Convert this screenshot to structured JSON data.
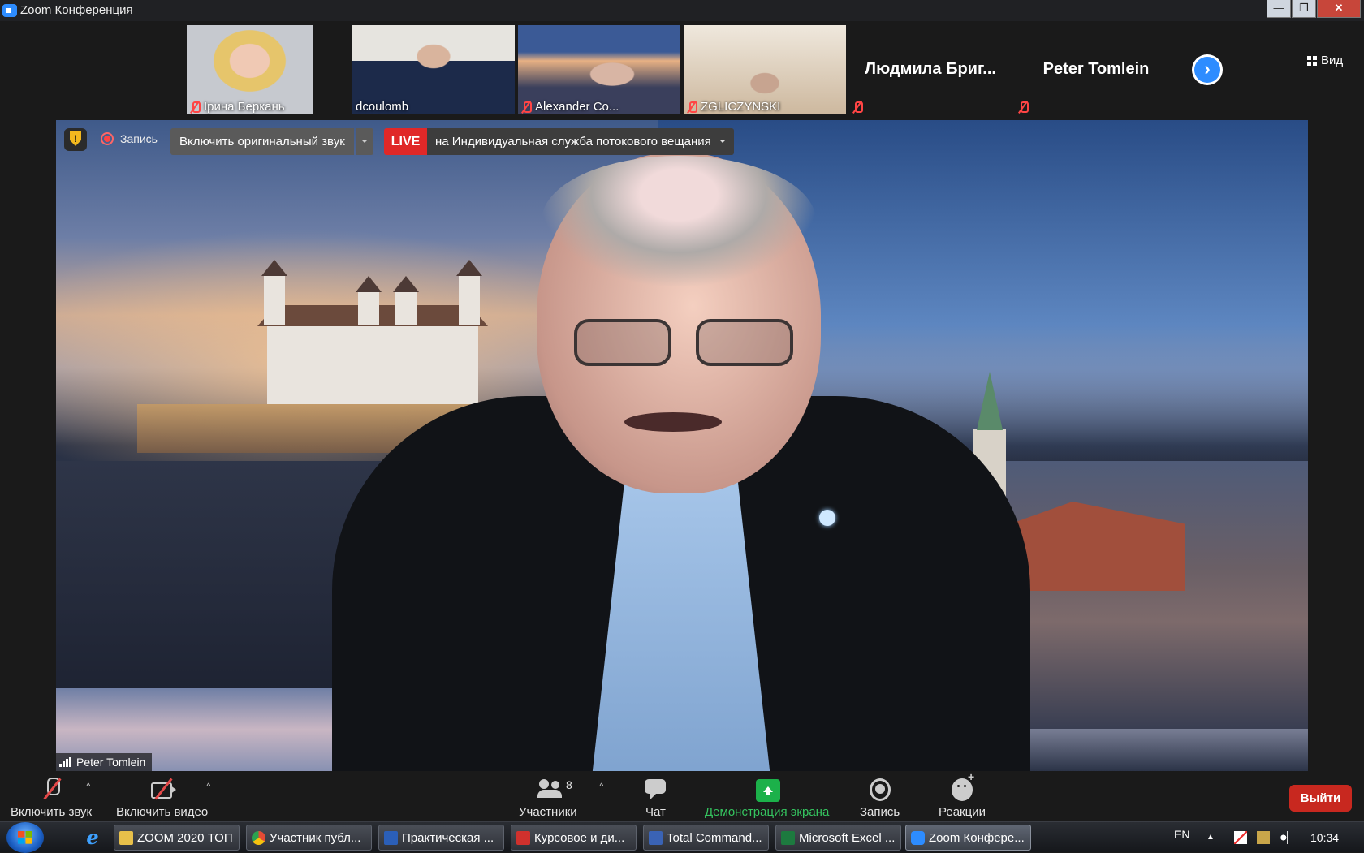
{
  "window": {
    "title": "Zoom Конференция",
    "controls": {
      "minimize": "—",
      "maximize": "❐",
      "close": "✕"
    }
  },
  "gallery": {
    "participants": [
      {
        "name": "Ірина Беркань",
        "muted": true
      },
      {
        "name": "dcoulomb",
        "muted": false
      },
      {
        "name": "Alexander Co...",
        "muted": true
      },
      {
        "name": "ZGLICZYNSKI",
        "muted": true
      },
      {
        "name": "Людмила  Бриг...",
        "muted": true
      },
      {
        "name": "Peter Tomlein",
        "muted": true
      }
    ],
    "next_icon": "chevron-right-icon",
    "next_label": "›",
    "view_label": "Вид"
  },
  "main_video": {
    "recording_label": "Запись",
    "original_audio_label": "Включить оригинальный звук",
    "live_badge": "LIVE",
    "live_service": "на Индивидуальная служба потокового вещания",
    "speaker_name": "Peter Tomlein"
  },
  "toolbar": {
    "mute_label": "Включить звук",
    "video_label": "Включить видео",
    "participants_label": "Участники",
    "participants_count": "8",
    "chat_label": "Чат",
    "share_label": "Демонстрация экрана",
    "record_label": "Запись",
    "reactions_label": "Реакции",
    "leave_label": "Выйти",
    "caret": "^",
    "colors": {
      "share": "#1cb14a",
      "leave": "#c8281f",
      "muted": "#e34848"
    }
  },
  "taskbar": {
    "items": [
      {
        "label": "ZOOM 2020 ТОП",
        "icon": "folder-icon",
        "color": "#e8c04a"
      },
      {
        "label": "Участник публ...",
        "icon": "chrome-icon",
        "color": "#e44b35"
      },
      {
        "label": "Практическая ...",
        "icon": "word-icon",
        "color": "#2b5fb8"
      },
      {
        "label": "Курсовое и ди...",
        "icon": "pdf-icon",
        "color": "#d0312d"
      },
      {
        "label": "Total Command...",
        "icon": "floppy-icon",
        "color": "#3a63b5"
      },
      {
        "label": "Microsoft Excel ...",
        "icon": "excel-icon",
        "color": "#1d7a3f"
      },
      {
        "label": "Zoom Конфере...",
        "icon": "zoom-icon",
        "color": "#2d8cff"
      }
    ],
    "lang": "EN",
    "tray_arrow": "▲",
    "time": "10:34"
  }
}
